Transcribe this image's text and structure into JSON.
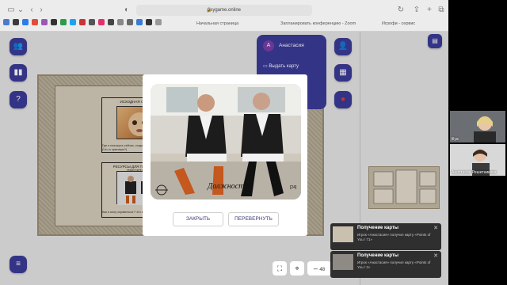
{
  "browser": {
    "url": "psygame.online",
    "tabs": [
      "Начальная страница",
      "Запланировать конференцию - Zoom",
      "Игрофи - сервис"
    ]
  },
  "player": {
    "initial": "А",
    "name": "Анастасия",
    "give_card_label": "Выдать карту"
  },
  "board": {
    "panel1_title": "ИСХОДНАЯ СИТУАЦИЯ",
    "panel1_caption": "Где я нахожусь сейчас, когда только начинаю этот путь? (Что я чувствую?)",
    "panel2_title": "РЕСУРСЫ ДЛЯ ПРЕОДОЛЕНИЯ ПРЕПЯТСТВИЙ",
    "panel2_caption": "Как я могу справиться? Что мне поможет?"
  },
  "modal": {
    "card_caption": "Должностны",
    "card_number": "[24]",
    "close_label": "ЗАКРЫТЬ",
    "flip_label": "ПЕРЕВЕРНУТЬ"
  },
  "zoom": {
    "level": "48"
  },
  "notifications": [
    {
      "title": "Получение карты",
      "body": "Игрок «Анастасия» получил карту «Points of You / 71»"
    },
    {
      "title": "Получение карты",
      "body": "Игрок «Анастасия» получил карту «Points of You / 3»"
    }
  ],
  "participants": [
    {
      "name": "lilya"
    },
    {
      "name": "Анастасия Решетникова"
    }
  ],
  "colors": {
    "accent": "#3c3c9a",
    "avatar": "#7a3fa8"
  }
}
